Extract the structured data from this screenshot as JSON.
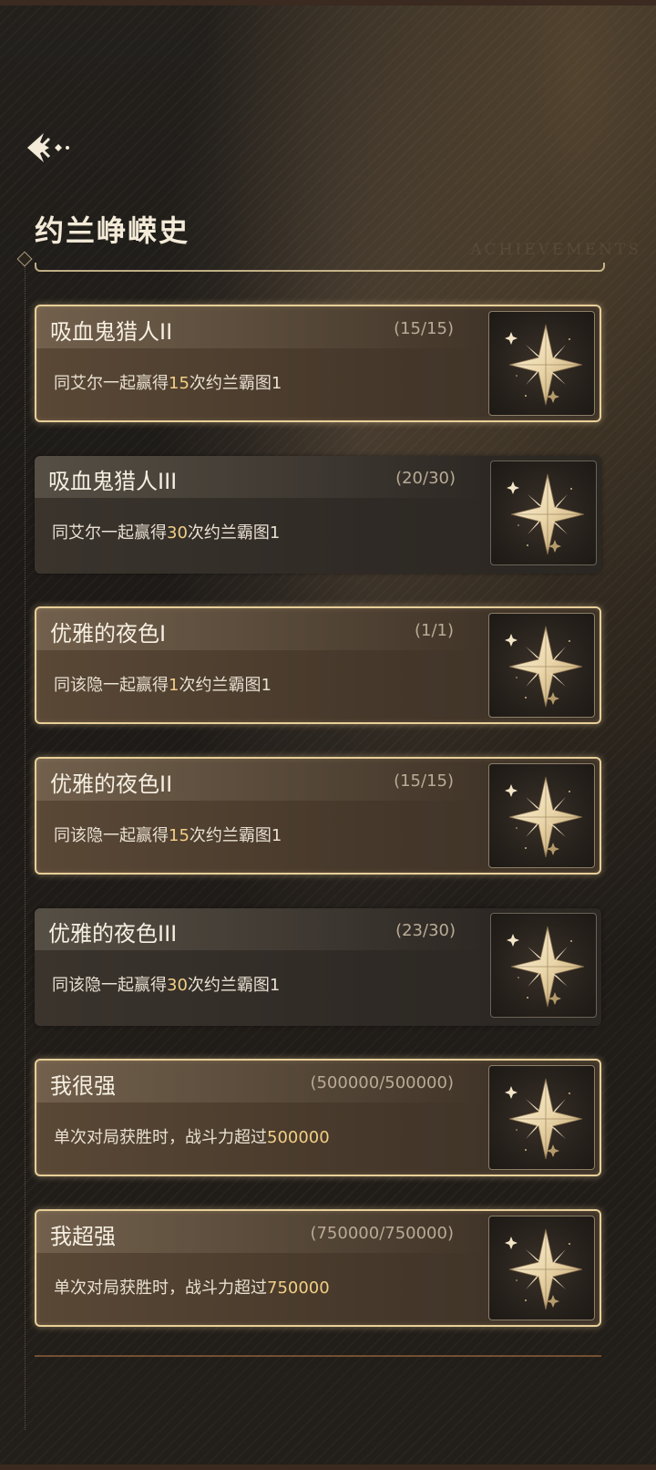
{
  "header": {
    "title": "约兰峥嵘史",
    "watermark": "ACHIEVEMENTS"
  },
  "achievements": [
    {
      "title": "吸血鬼猎人II",
      "count": "(15/15)",
      "desc_before": "同艾尔一起赢得",
      "desc_num": "15",
      "desc_after": "次约兰霸图1",
      "status": "completed"
    },
    {
      "title": "吸血鬼猎人III",
      "count": "(20/30)",
      "desc_before": "同艾尔一起赢得",
      "desc_num": "30",
      "desc_after": "次约兰霸图1",
      "status": "in-progress"
    },
    {
      "title": "优雅的夜色I",
      "count": "(1/1)",
      "desc_before": "同该隐一起赢得",
      "desc_num": "1",
      "desc_after": "次约兰霸图1",
      "status": "completed"
    },
    {
      "title": "优雅的夜色II",
      "count": "(15/15)",
      "desc_before": "同该隐一起赢得",
      "desc_num": "15",
      "desc_after": "次约兰霸图1",
      "status": "completed"
    },
    {
      "title": "优雅的夜色III",
      "count": "(23/30)",
      "desc_before": "同该隐一起赢得",
      "desc_num": "30",
      "desc_after": "次约兰霸图1",
      "status": "in-progress"
    },
    {
      "title": "我很强",
      "count": "(500000/500000)",
      "desc_before": "单次对局获胜时，战斗力超过",
      "desc_num": "500000",
      "desc_after": "",
      "status": "completed"
    },
    {
      "title": "我超强",
      "count": "(750000/750000)",
      "desc_before": "单次对局获胜时，战斗力超过",
      "desc_num": "750000",
      "desc_after": "",
      "status": "completed"
    }
  ],
  "icons": {
    "back": "back-arrow-icon",
    "badge": "compass-star-icon"
  },
  "colors": {
    "gold_border": "#e8cf98",
    "highlight_number": "#f2cf86",
    "title_text": "#f3ead8"
  }
}
